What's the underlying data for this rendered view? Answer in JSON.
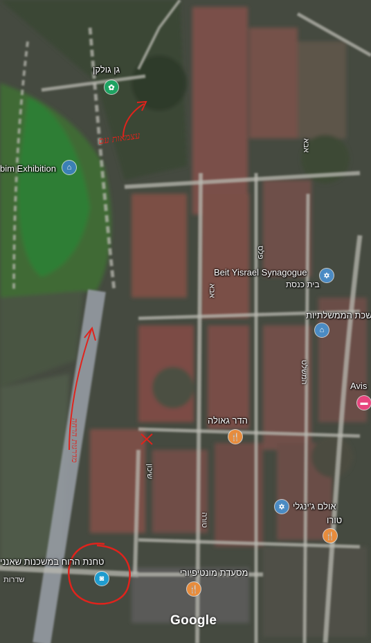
{
  "map": {
    "attribution": "Google",
    "pois": [
      {
        "name": "גן גולקן",
        "icon": "park-icon",
        "color": "#1ea362"
      },
      {
        "name": "bim Exhibition",
        "icon": "museum-icon",
        "color": "#3b80b4"
      },
      {
        "name": "Beit Yisrael Synagogue",
        "subname": "בית כנסת",
        "icon": "synagogue-icon",
        "color": "#4b8bc4"
      },
      {
        "name": "שכת הממשלתיות",
        "icon": "museum-icon",
        "color": "#4b8bc4"
      },
      {
        "name": "Avis",
        "icon": "hotel-icon",
        "color": "#e7457e"
      },
      {
        "name": "הדר גאולה",
        "icon": "restaurant-icon",
        "color": "#e88c3c"
      },
      {
        "name": "אולם ג'ינגלי",
        "icon": "synagogue-icon",
        "color": "#4b8bc4"
      },
      {
        "name": "טורו",
        "icon": "restaurant-icon",
        "color": "#e88c3c"
      },
      {
        "name": "מסעדת מונטיפיורי",
        "icon": "restaurant-icon",
        "color": "#e88c3c"
      },
      {
        "name": "טחנת הרוח במשכנות שאנני",
        "icon": "camera-icon",
        "color": "#1f9ccf"
      }
    ],
    "streets": [
      "אבא",
      "אבא",
      "המשלט",
      "פלס",
      "טורה",
      "שדרות",
      "שיכון"
    ],
    "annotations": {
      "handwriting_top": "עצמאות עם",
      "handwriting_path": "מדרגות הרחה",
      "accent_color": "#e0231c"
    }
  }
}
